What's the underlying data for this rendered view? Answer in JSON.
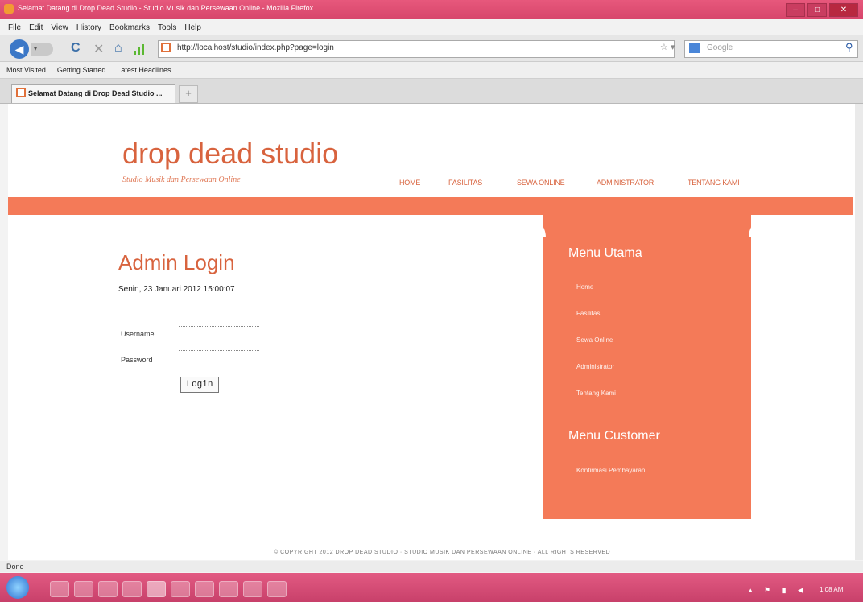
{
  "window": {
    "title": "Selamat Datang di Drop Dead Studio - Studio Musik dan Persewaan Online - Mozilla Firefox",
    "buttons": [
      "–",
      "□",
      "✕"
    ]
  },
  "menu": [
    "File",
    "Edit",
    "View",
    "History",
    "Bookmarks",
    "Tools",
    "Help"
  ],
  "toolbar": {
    "back_icon": "back-arrow-icon",
    "reload": "C",
    "stop": "✕",
    "home": "⌂",
    "url": "http://localhost/studio/index.php?page=login",
    "search_placeholder": "Google"
  },
  "bookmarks": [
    "Most Visited",
    "Getting Started",
    "Latest Headlines"
  ],
  "tab": {
    "title": "Selamat Datang di Drop Dead Studio ...",
    "new_tab": "+"
  },
  "site": {
    "logo": "drop dead studio",
    "tagline": "Studio Musik dan Persewaan Online",
    "nav": [
      "HOME",
      "FASILITAS",
      "SEWA ONLINE",
      "ADMINISTRATOR",
      "TENTANG KAMI"
    ]
  },
  "login": {
    "title": "Admin Login",
    "date": "Senin, 23 Januari 2012 15:00:07",
    "username_label": "Username",
    "password_label": "Password",
    "button": "Login"
  },
  "sidebar": {
    "menu_utama_title": "Menu Utama",
    "menu_utama_items": [
      "Home",
      "Fasilitas",
      "Sewa Online",
      "Administrator",
      "Tentang Kami"
    ],
    "menu_customer_title": "Menu Customer",
    "menu_customer_items": [
      "Konfirmasi Pembayaran"
    ]
  },
  "footer": "© COPYRIGHT 2012 DROP DEAD STUDIO · STUDIO MUSIK DAN PERSEWAAN ONLINE · ALL RIGHTS RESERVED",
  "status": "Done",
  "taskbar": {
    "clock": "1:08 AM"
  }
}
